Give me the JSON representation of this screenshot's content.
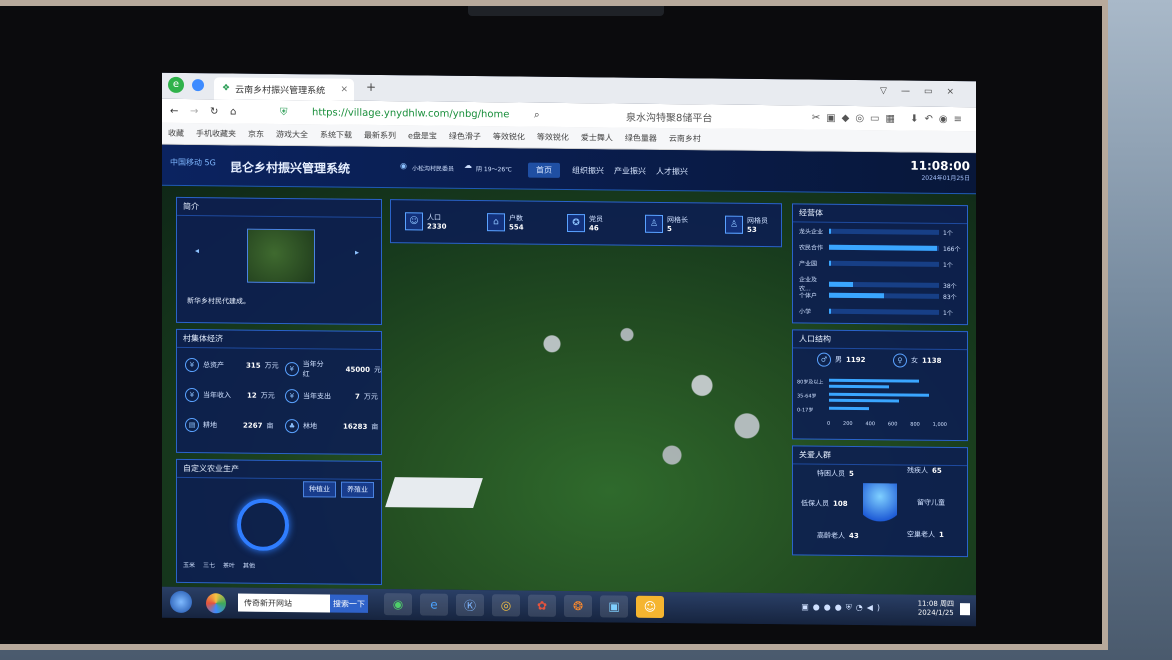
{
  "browser": {
    "tab_title": "云南乡村振兴管理系统",
    "url": "https://village.ynydhlw.com/ynbg/home",
    "search_text": "泉水沟特聚8储平台",
    "bookmarks": [
      "收藏",
      "手机收藏夹",
      "京东",
      "游戏大全",
      "系统下载",
      "最新系列",
      "e盘是宝",
      "绿色滑子",
      "等效锐化",
      "等效锐化",
      "爱士舞人",
      "绿色量器",
      "云南乡村"
    ]
  },
  "header": {
    "logo": "中国移动 5G",
    "title": "昆仑乡村振兴管理系统",
    "location": "小松沟村民委员",
    "weather": "阴 19～26℃",
    "nav": [
      "首页",
      "组织振兴",
      "产业振兴",
      "人才振兴"
    ],
    "time": "11:08:00",
    "date": "2024年01月25日"
  },
  "top_stats": [
    {
      "label": "人口",
      "value": "2330"
    },
    {
      "label": "户数",
      "value": "554"
    },
    {
      "label": "党员",
      "value": "46"
    },
    {
      "label": "网格长",
      "value": "5"
    },
    {
      "label": "网格员",
      "value": "53"
    }
  ],
  "intro": {
    "title": "简介",
    "caption": "新华乡村民代建成。"
  },
  "economy": {
    "title": "村集体经济",
    "items": [
      {
        "label": "总资产",
        "value": "315",
        "unit": "万元"
      },
      {
        "label": "当年分红",
        "value": "45000",
        "unit": "元"
      },
      {
        "label": "当年收入",
        "value": "12",
        "unit": "万元"
      },
      {
        "label": "当年支出",
        "value": "7",
        "unit": "万元"
      },
      {
        "label": "耕地",
        "value": "2267",
        "unit": "亩"
      },
      {
        "label": "林地",
        "value": "16283",
        "unit": "亩"
      }
    ]
  },
  "agri": {
    "title": "自定义农业生产",
    "buttons": [
      "种植业",
      "养殖业"
    ],
    "legend": [
      "玉米",
      "三七",
      "茶叶",
      "其他"
    ]
  },
  "subjects": {
    "title": "经营体",
    "items": [
      {
        "label": "龙头企业",
        "count": "1个",
        "pct": 0.01
      },
      {
        "label": "农民合作",
        "count": "166个",
        "pct": 0.98
      },
      {
        "label": "产业园",
        "count": "1个",
        "pct": 0.01
      },
      {
        "label": "企业及农...",
        "count": "38个",
        "pct": 0.22
      },
      {
        "label": "个体户",
        "count": "83个",
        "pct": 0.5
      },
      {
        "label": "小学",
        "count": "1个",
        "pct": 0.01
      }
    ]
  },
  "population": {
    "title": "人口结构",
    "male_label": "男",
    "male": "1192",
    "female_label": "女",
    "female": "1138",
    "age_groups": [
      "80岁及以上",
      "35-64岁",
      "0-17岁"
    ],
    "xticks": [
      "0",
      "200",
      "400",
      "600",
      "800",
      "1,000"
    ]
  },
  "care": {
    "title": "关爱人群",
    "items": [
      {
        "label": "特困人员",
        "value": "5"
      },
      {
        "label": "残疾人",
        "value": "65"
      },
      {
        "label": "低保人员",
        "value": "108"
      },
      {
        "label": "留守儿童",
        "value": ""
      },
      {
        "label": "高龄老人",
        "value": "43"
      },
      {
        "label": "空巢老人",
        "value": "1"
      }
    ]
  },
  "taskbar": {
    "search_text": "传奇新开网站",
    "search_button": "搜索一下",
    "time": "11:08 周四",
    "date": "2024/1/25"
  }
}
